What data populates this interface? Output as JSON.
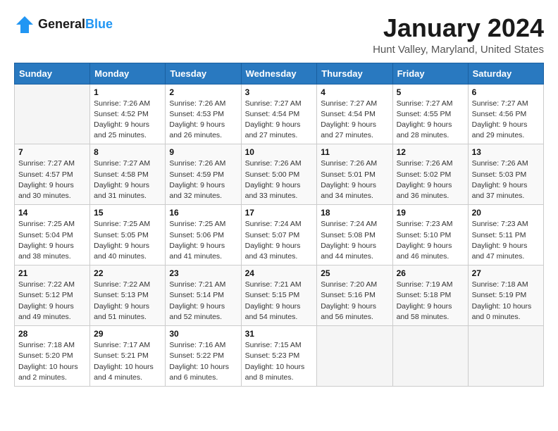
{
  "header": {
    "logo_line1": "General",
    "logo_line2": "Blue",
    "title": "January 2024",
    "subtitle": "Hunt Valley, Maryland, United States"
  },
  "weekdays": [
    "Sunday",
    "Monday",
    "Tuesday",
    "Wednesday",
    "Thursday",
    "Friday",
    "Saturday"
  ],
  "weeks": [
    [
      {
        "num": "",
        "empty": true
      },
      {
        "num": "1",
        "sunrise": "7:26 AM",
        "sunset": "4:52 PM",
        "daylight": "9 hours and 25 minutes."
      },
      {
        "num": "2",
        "sunrise": "7:26 AM",
        "sunset": "4:53 PM",
        "daylight": "9 hours and 26 minutes."
      },
      {
        "num": "3",
        "sunrise": "7:27 AM",
        "sunset": "4:54 PM",
        "daylight": "9 hours and 27 minutes."
      },
      {
        "num": "4",
        "sunrise": "7:27 AM",
        "sunset": "4:54 PM",
        "daylight": "9 hours and 27 minutes."
      },
      {
        "num": "5",
        "sunrise": "7:27 AM",
        "sunset": "4:55 PM",
        "daylight": "9 hours and 28 minutes."
      },
      {
        "num": "6",
        "sunrise": "7:27 AM",
        "sunset": "4:56 PM",
        "daylight": "9 hours and 29 minutes."
      }
    ],
    [
      {
        "num": "7",
        "sunrise": "7:27 AM",
        "sunset": "4:57 PM",
        "daylight": "9 hours and 30 minutes."
      },
      {
        "num": "8",
        "sunrise": "7:27 AM",
        "sunset": "4:58 PM",
        "daylight": "9 hours and 31 minutes."
      },
      {
        "num": "9",
        "sunrise": "7:26 AM",
        "sunset": "4:59 PM",
        "daylight": "9 hours and 32 minutes."
      },
      {
        "num": "10",
        "sunrise": "7:26 AM",
        "sunset": "5:00 PM",
        "daylight": "9 hours and 33 minutes."
      },
      {
        "num": "11",
        "sunrise": "7:26 AM",
        "sunset": "5:01 PM",
        "daylight": "9 hours and 34 minutes."
      },
      {
        "num": "12",
        "sunrise": "7:26 AM",
        "sunset": "5:02 PM",
        "daylight": "9 hours and 36 minutes."
      },
      {
        "num": "13",
        "sunrise": "7:26 AM",
        "sunset": "5:03 PM",
        "daylight": "9 hours and 37 minutes."
      }
    ],
    [
      {
        "num": "14",
        "sunrise": "7:25 AM",
        "sunset": "5:04 PM",
        "daylight": "9 hours and 38 minutes."
      },
      {
        "num": "15",
        "sunrise": "7:25 AM",
        "sunset": "5:05 PM",
        "daylight": "9 hours and 40 minutes."
      },
      {
        "num": "16",
        "sunrise": "7:25 AM",
        "sunset": "5:06 PM",
        "daylight": "9 hours and 41 minutes."
      },
      {
        "num": "17",
        "sunrise": "7:24 AM",
        "sunset": "5:07 PM",
        "daylight": "9 hours and 43 minutes."
      },
      {
        "num": "18",
        "sunrise": "7:24 AM",
        "sunset": "5:08 PM",
        "daylight": "9 hours and 44 minutes."
      },
      {
        "num": "19",
        "sunrise": "7:23 AM",
        "sunset": "5:10 PM",
        "daylight": "9 hours and 46 minutes."
      },
      {
        "num": "20",
        "sunrise": "7:23 AM",
        "sunset": "5:11 PM",
        "daylight": "9 hours and 47 minutes."
      }
    ],
    [
      {
        "num": "21",
        "sunrise": "7:22 AM",
        "sunset": "5:12 PM",
        "daylight": "9 hours and 49 minutes."
      },
      {
        "num": "22",
        "sunrise": "7:22 AM",
        "sunset": "5:13 PM",
        "daylight": "9 hours and 51 minutes."
      },
      {
        "num": "23",
        "sunrise": "7:21 AM",
        "sunset": "5:14 PM",
        "daylight": "9 hours and 52 minutes."
      },
      {
        "num": "24",
        "sunrise": "7:21 AM",
        "sunset": "5:15 PM",
        "daylight": "9 hours and 54 minutes."
      },
      {
        "num": "25",
        "sunrise": "7:20 AM",
        "sunset": "5:16 PM",
        "daylight": "9 hours and 56 minutes."
      },
      {
        "num": "26",
        "sunrise": "7:19 AM",
        "sunset": "5:18 PM",
        "daylight": "9 hours and 58 minutes."
      },
      {
        "num": "27",
        "sunrise": "7:18 AM",
        "sunset": "5:19 PM",
        "daylight": "10 hours and 0 minutes."
      }
    ],
    [
      {
        "num": "28",
        "sunrise": "7:18 AM",
        "sunset": "5:20 PM",
        "daylight": "10 hours and 2 minutes."
      },
      {
        "num": "29",
        "sunrise": "7:17 AM",
        "sunset": "5:21 PM",
        "daylight": "10 hours and 4 minutes."
      },
      {
        "num": "30",
        "sunrise": "7:16 AM",
        "sunset": "5:22 PM",
        "daylight": "10 hours and 6 minutes."
      },
      {
        "num": "31",
        "sunrise": "7:15 AM",
        "sunset": "5:23 PM",
        "daylight": "10 hours and 8 minutes."
      },
      {
        "num": "",
        "empty": true
      },
      {
        "num": "",
        "empty": true
      },
      {
        "num": "",
        "empty": true
      }
    ]
  ]
}
